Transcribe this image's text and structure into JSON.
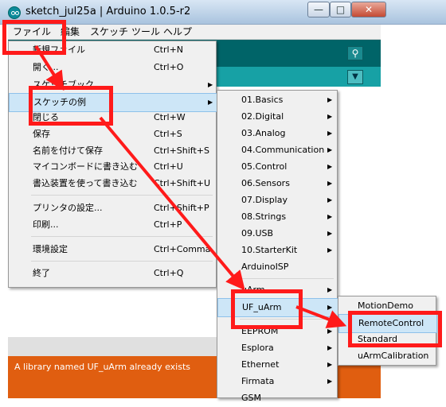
{
  "window": {
    "title": "sketch_jul25a | Arduino 1.0.5-r2",
    "min": "—",
    "max": "□",
    "close": "✕"
  },
  "menubar": [
    "ファイル",
    "編集",
    "スケッチ",
    "ツール",
    "ヘルプ"
  ],
  "file_menu": {
    "items": [
      {
        "label": "新規ファイル",
        "shortcut": "Ctrl+N"
      },
      {
        "label": "開く...",
        "shortcut": "Ctrl+O"
      },
      {
        "label": "スケッチブック",
        "shortcut": ""
      },
      {
        "label": "スケッチの例",
        "shortcut": ""
      },
      {
        "label": "閉じる",
        "shortcut": "Ctrl+W"
      },
      {
        "label": "保存",
        "shortcut": "Ctrl+S"
      },
      {
        "label": "名前を付けて保存",
        "shortcut": "Ctrl+Shift+S"
      },
      {
        "label": "マイコンボードに書き込む",
        "shortcut": "Ctrl+U"
      },
      {
        "label": "書込装置を使って書き込む",
        "shortcut": "Ctrl+Shift+U"
      },
      {
        "label": "プリンタの設定...",
        "shortcut": "Ctrl+Shift+P"
      },
      {
        "label": "印刷...",
        "shortcut": "Ctrl+P"
      },
      {
        "label": "環境設定",
        "shortcut": "Ctrl+Comma"
      },
      {
        "label": "終了",
        "shortcut": "Ctrl+Q"
      }
    ]
  },
  "examples_menu": {
    "items": [
      "01.Basics",
      "02.Digital",
      "03.Analog",
      "04.Communication",
      "05.Control",
      "06.Sensors",
      "07.Display",
      "08.Strings",
      "09.USB",
      "10.StarterKit",
      "ArduinoISP",
      "uArm",
      "UF_uArm",
      "EEPROM",
      "Esplora",
      "Ethernet",
      "Firmata",
      "GSM"
    ]
  },
  "uf_uarm_menu": {
    "items": [
      "MotionDemo",
      "RemoteControl",
      "Standard",
      "uArmCalibration"
    ]
  },
  "console": {
    "message": "A library named UF_uArm already exists"
  },
  "colors": {
    "annotation": "#ff1a1a",
    "toolbar": "#006468",
    "console": "#e05e10"
  },
  "icons": {
    "serial_monitor": "magnifier-icon",
    "tab_menu": "down-triangle-icon"
  }
}
